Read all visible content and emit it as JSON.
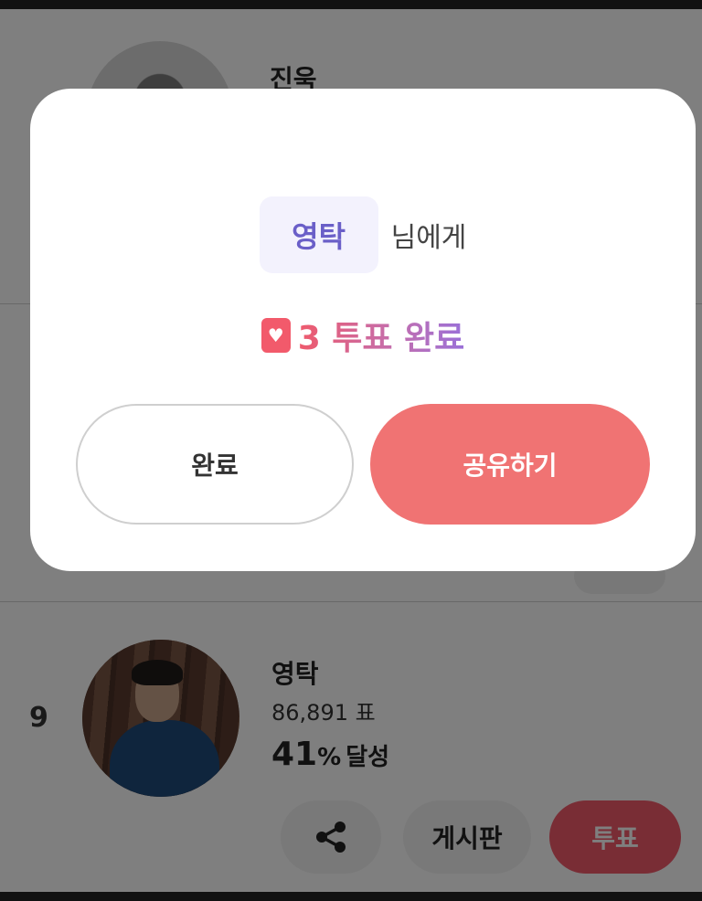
{
  "background": {
    "top_row": {
      "name": "진욱"
    },
    "row9": {
      "rank": "9",
      "name": "영탁",
      "votes": "86,891 표",
      "percent_value": "41",
      "percent_sign": "%",
      "percent_label": "달성"
    },
    "actions": {
      "board_label": "게시판",
      "vote_label": "투표"
    }
  },
  "modal": {
    "recipient_name": "영탁",
    "recipient_suffix": "님에게",
    "vote_count_text": "3 투표 완료",
    "complete_label": "완료",
    "share_label": "공유하기"
  },
  "colors": {
    "accent_pink": "#f07373",
    "accent_purple": "#6a5fc8",
    "vote_red": "#f25a6b"
  }
}
